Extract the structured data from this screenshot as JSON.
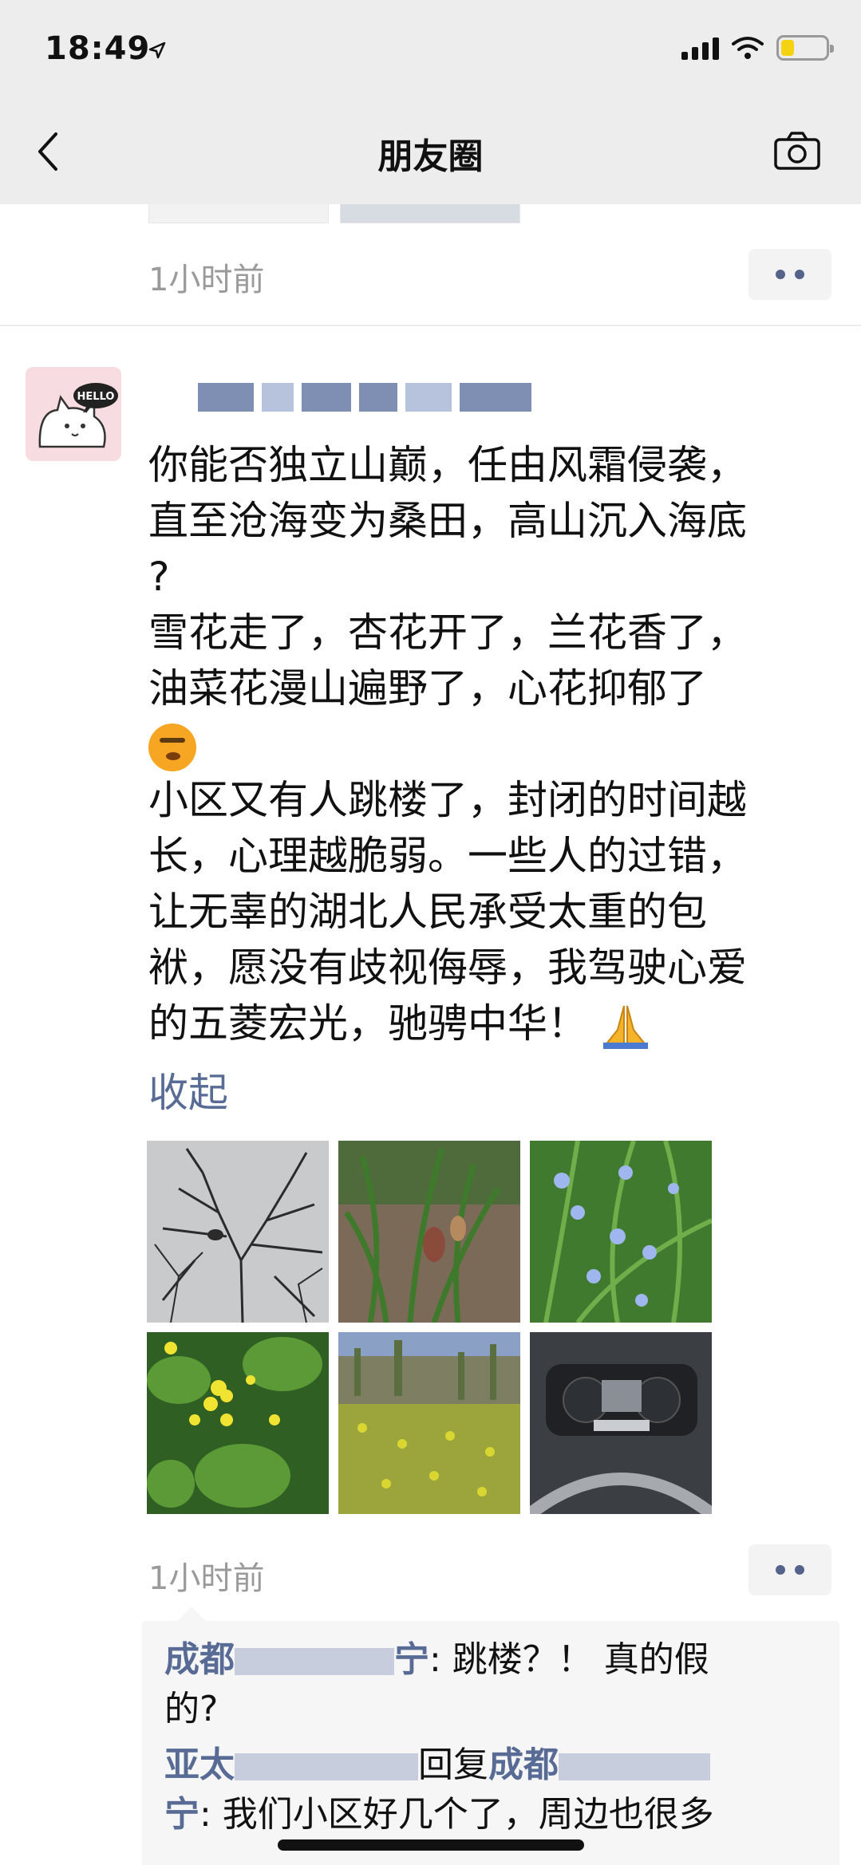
{
  "status": {
    "time": "18:49",
    "battery_color": "#f5d312"
  },
  "nav": {
    "title": "朋友圈",
    "back_icon": "chevron-left-icon",
    "camera_icon": "camera-icon"
  },
  "previous_post": {
    "time": "1小时前"
  },
  "post": {
    "avatar_text": "HELLO",
    "paragraphs": [
      "你能否独立山巅，任由风霜侵袭，\n直至沧海变为桑田，高山沉入海底\n?",
      "雪花走了，杏花开了，兰花香了，\n油菜花漫山遍野了，心花抑郁了",
      "小区又有人跳楼了，封闭的时间越\n长，心理越脆弱。一些人的过错，\n让无辜的湖北人民承受太重的包\n袱，愿没有歧视侮辱，我驾驶心爱\n的五菱宏光，驰骋中华！"
    ],
    "collapse_label": "收起",
    "time": "1小时前",
    "photos": [
      "bare-tree-branches",
      "orchid-plant",
      "blue-flowers",
      "rapeseed-flowers",
      "rapeseed-field",
      "car-dashboard"
    ]
  },
  "comments": [
    {
      "name_prefix": "成都",
      "name_suffix": "宁",
      "text": ": 跳楼？！ 真的假",
      "text2": "的?"
    },
    {
      "name_prefix": "亚太",
      "reply_label": "回复",
      "reply_name_prefix": "成都",
      "name_suffix": "宁",
      "text": ": 我们小区好几个了，周边也很多"
    }
  ],
  "colors": {
    "link": "#576b95",
    "header_bg": "#ededed"
  }
}
